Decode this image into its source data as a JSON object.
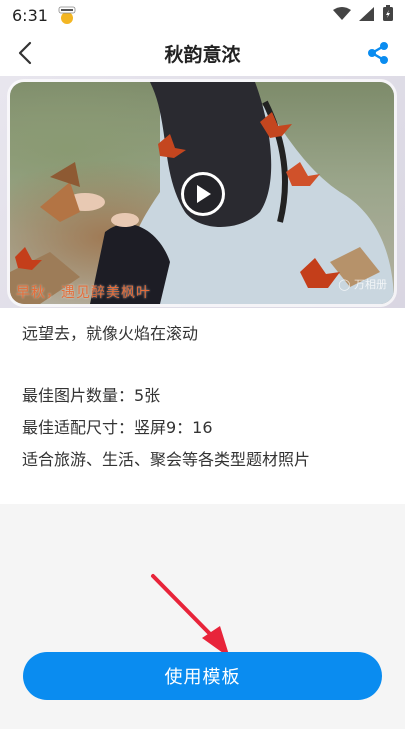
{
  "status_bar": {
    "time": "6:31",
    "icons": [
      "weather-icon",
      "wifi-icon",
      "signal-icon",
      "battery-icon"
    ]
  },
  "header": {
    "title": "秋韵意浓",
    "back_icon": "back-arrow-icon",
    "share_icon": "share-icon"
  },
  "video": {
    "caption": "早秋，遇见醉美枫叶",
    "watermark": "◯ 万相册",
    "play_icon": "play-icon"
  },
  "description": {
    "line1": "远望去，就像火焰在滚动",
    "line2": "最佳图片数量：5张",
    "line3": "最佳适配尺寸：竖屏9：16",
    "line4": "适合旅游、生活、聚会等各类型题材照片"
  },
  "action": {
    "use_template_label": "使用模板"
  },
  "colors": {
    "accent": "#0a8cf0",
    "annotation_arrow": "#e8243a",
    "caption": "#e46d3a"
  }
}
